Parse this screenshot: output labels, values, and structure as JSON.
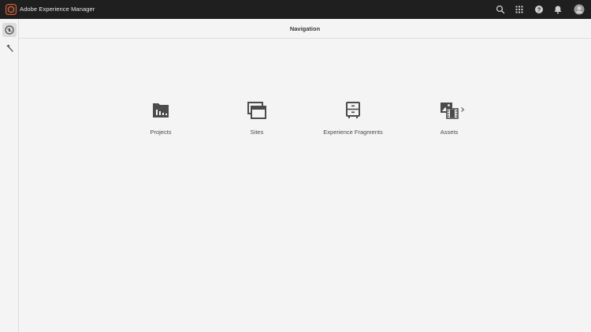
{
  "app": {
    "title": "Adobe Experience Manager",
    "accent_color": "#eb5f2d"
  },
  "topbar": {
    "icons": [
      "search-icon",
      "apps-grid-icon",
      "help-icon",
      "notifications-bell-icon",
      "user-avatar"
    ]
  },
  "rail": {
    "items": [
      {
        "name": "navigation",
        "icon": "compass-icon",
        "active": true
      },
      {
        "name": "tools",
        "icon": "hammer-icon",
        "active": false
      }
    ]
  },
  "header": {
    "title": "Navigation"
  },
  "navigation": {
    "items": [
      {
        "label": "Projects",
        "icon": "projects-icon"
      },
      {
        "label": "Sites",
        "icon": "sites-icon"
      },
      {
        "label": "Experience Fragments",
        "icon": "experience-fragments-icon"
      },
      {
        "label": "Assets",
        "icon": "assets-icon",
        "has_submenu": true
      }
    ]
  }
}
